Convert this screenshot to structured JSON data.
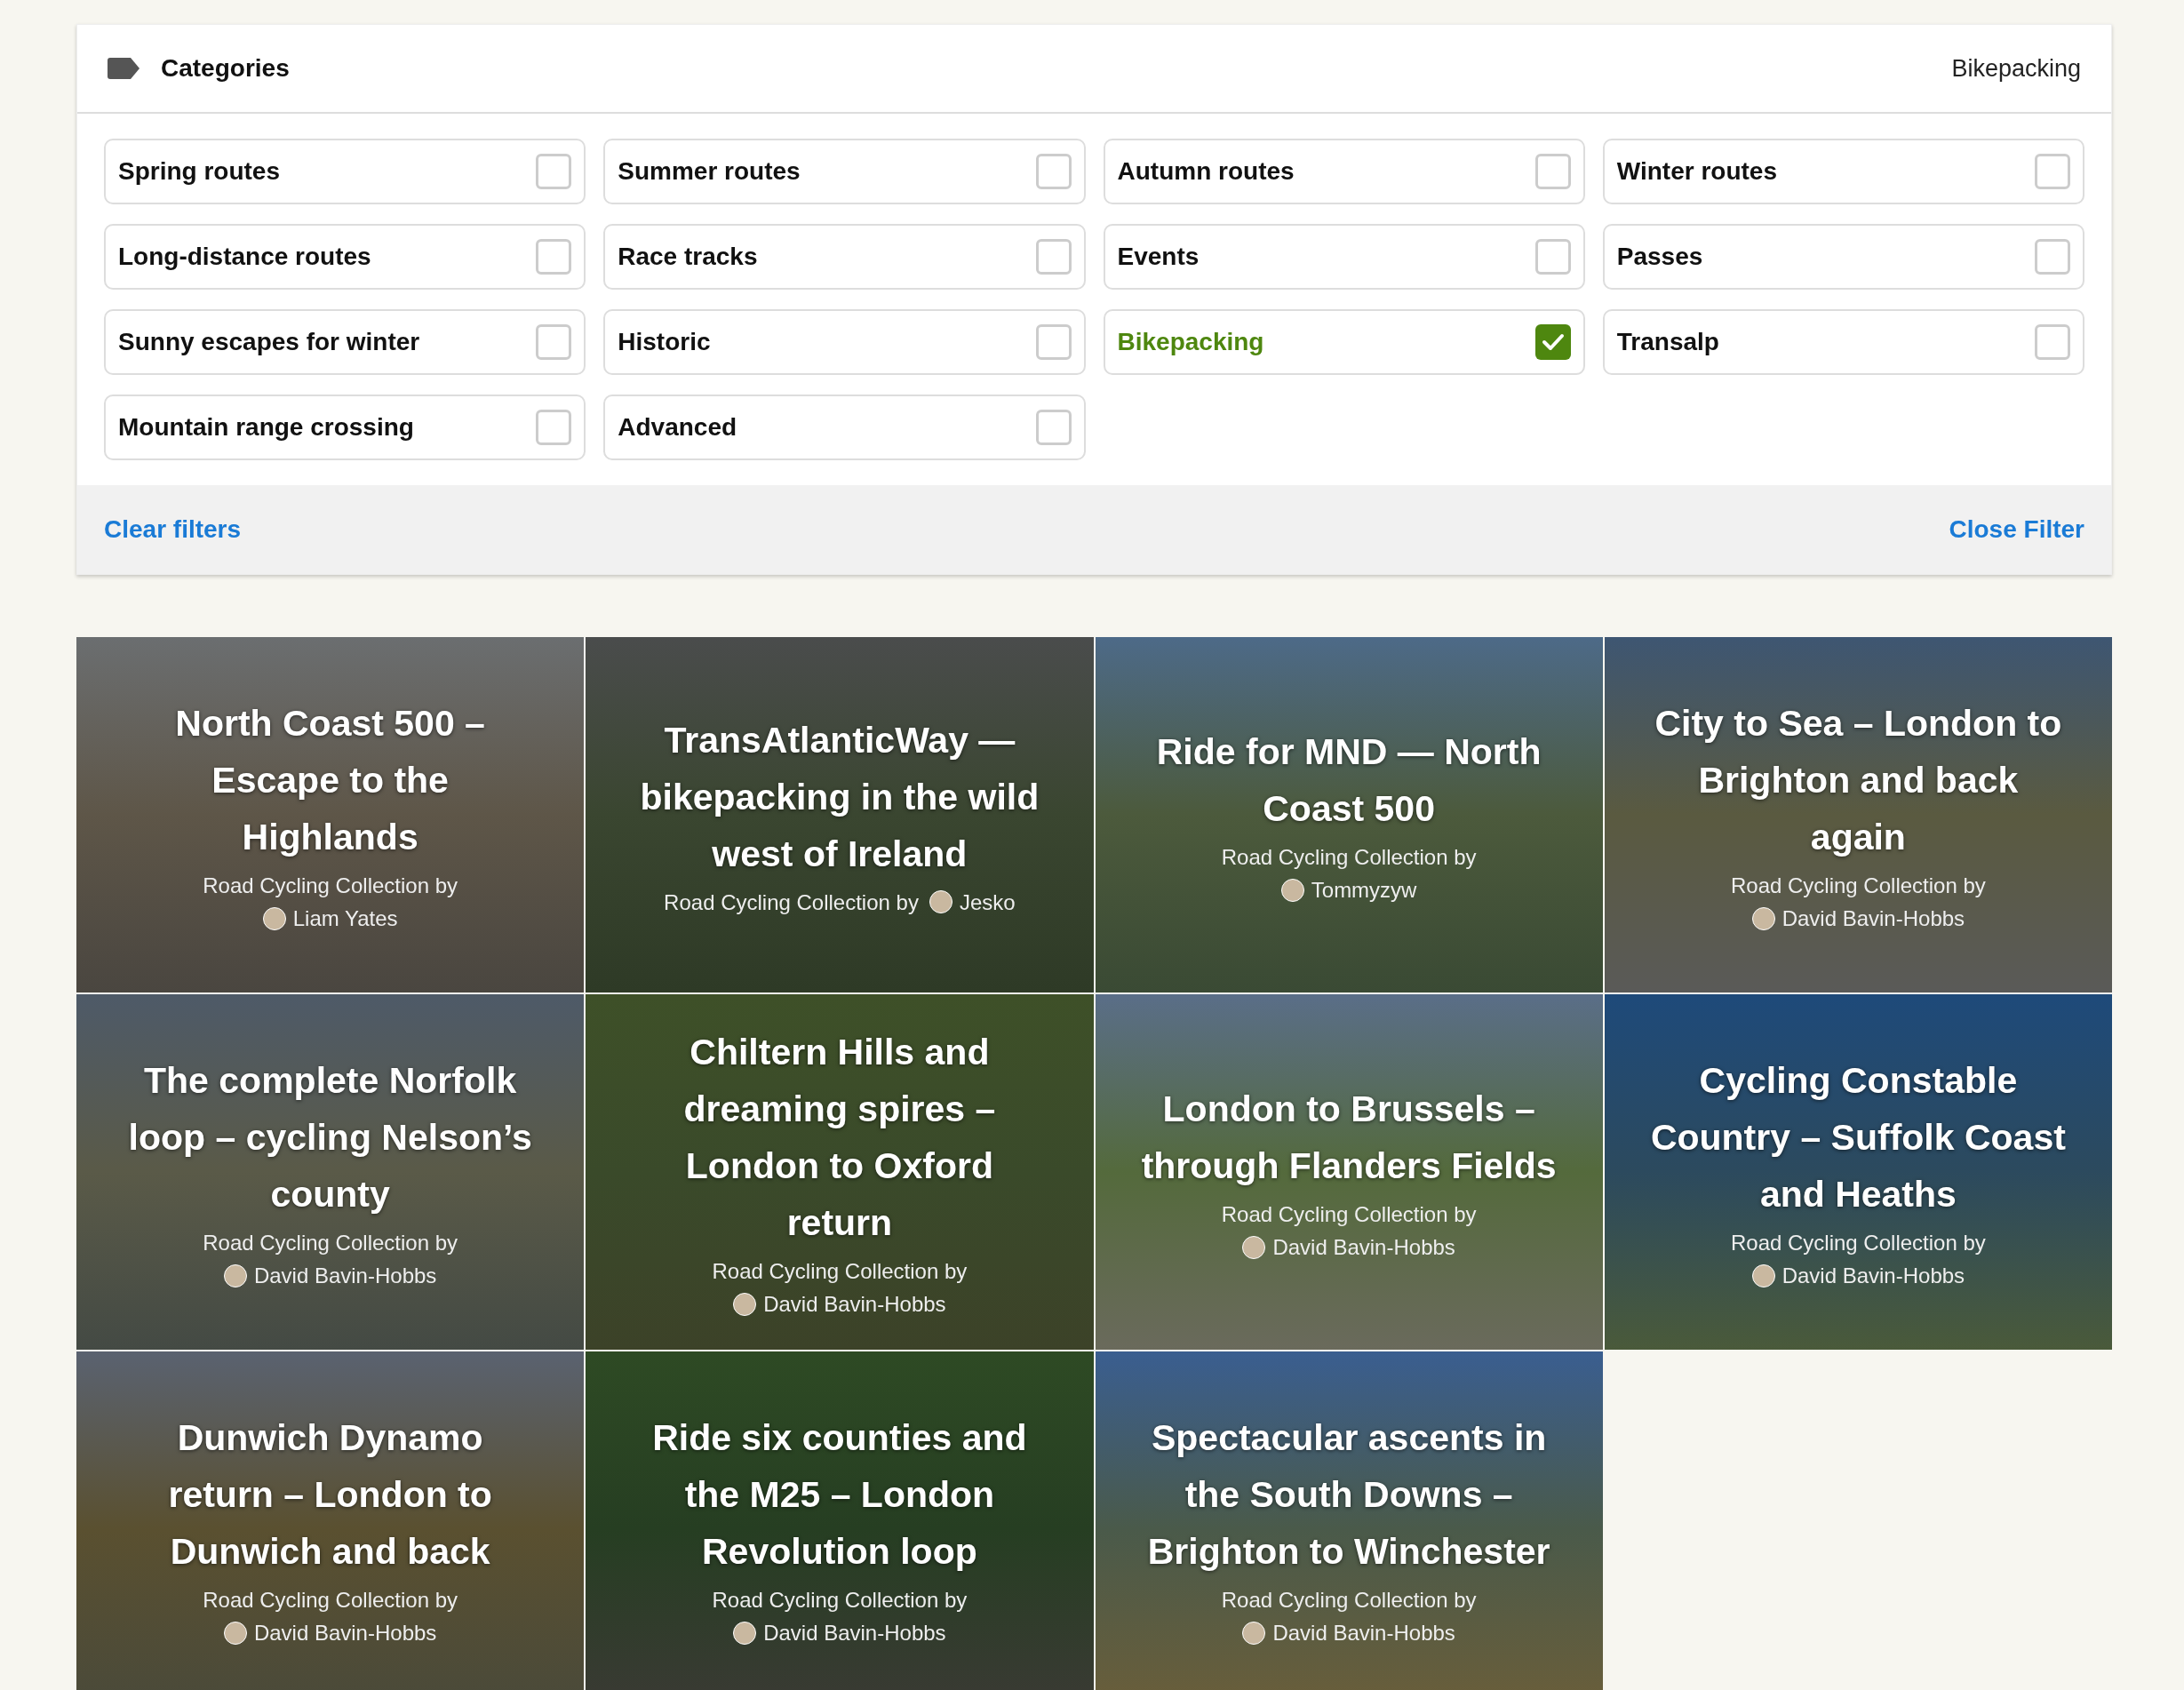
{
  "filter": {
    "title": "Categories",
    "summary": "Bikepacking",
    "categories": [
      {
        "label": "Spring routes",
        "checked": false
      },
      {
        "label": "Summer routes",
        "checked": false
      },
      {
        "label": "Autumn routes",
        "checked": false
      },
      {
        "label": "Winter routes",
        "checked": false
      },
      {
        "label": "Long-distance routes",
        "checked": false
      },
      {
        "label": "Race tracks",
        "checked": false
      },
      {
        "label": "Events",
        "checked": false
      },
      {
        "label": "Passes",
        "checked": false
      },
      {
        "label": "Sunny escapes for winter",
        "checked": false
      },
      {
        "label": "Historic",
        "checked": false
      },
      {
        "label": "Bikepacking",
        "checked": true
      },
      {
        "label": "Transalp",
        "checked": false
      },
      {
        "label": "Mountain range crossing",
        "checked": false
      },
      {
        "label": "Advanced",
        "checked": false
      }
    ],
    "clear_button": "Clear filters",
    "close_button": "Close Filter"
  },
  "collections": [
    {
      "title": "North Coast 500 – Escape to the Highlands",
      "subtitle": "Road Cycling Collection by",
      "author": "Liam Yates",
      "author_inline": false
    },
    {
      "title": "TransAtlanticWay — bikepacking in the wild west of Ireland",
      "subtitle": "Road Cycling Collection by",
      "author": "Jesko",
      "author_inline": true
    },
    {
      "title": "Ride for MND — North Coast 500",
      "subtitle": "Road Cycling Collection by",
      "author": "Tommyzyw",
      "author_inline": false
    },
    {
      "title": "City to Sea – London to Brighton and back again",
      "subtitle": "Road Cycling Collection by",
      "author": "David Bavin-Hobbs",
      "author_inline": false
    },
    {
      "title": "The complete Norfolk loop – cycling Nelson’s county",
      "subtitle": "Road Cycling Collection by",
      "author": "David Bavin-Hobbs",
      "author_inline": false
    },
    {
      "title": "Chiltern Hills and dreaming spires – London to Oxford return",
      "subtitle": "Road Cycling Collection by",
      "author": "David Bavin-Hobbs",
      "author_inline": false
    },
    {
      "title": "London to Brussels – through Flanders Fields",
      "subtitle": "Road Cycling Collection by",
      "author": "David Bavin-Hobbs",
      "author_inline": false
    },
    {
      "title": "Cycling Constable Country – Suffolk Coast and Heaths",
      "subtitle": "Road Cycling Collection by",
      "author": "David Bavin-Hobbs",
      "author_inline": false
    },
    {
      "title": "Dunwich Dynamo return – London to Dunwich and back",
      "subtitle": "Road Cycling Collection by",
      "author": "David Bavin-Hobbs",
      "author_inline": false
    },
    {
      "title": "Ride six counties and the M25 – London Revolution loop",
      "subtitle": "Road Cycling Collection by",
      "author": "David Bavin-Hobbs",
      "author_inline": false
    },
    {
      "title": "Spectacular ascents in the South Downs – Brighton to Winchester",
      "subtitle": "Road Cycling Collection by",
      "author": "David Bavin-Hobbs",
      "author_inline": false
    }
  ]
}
